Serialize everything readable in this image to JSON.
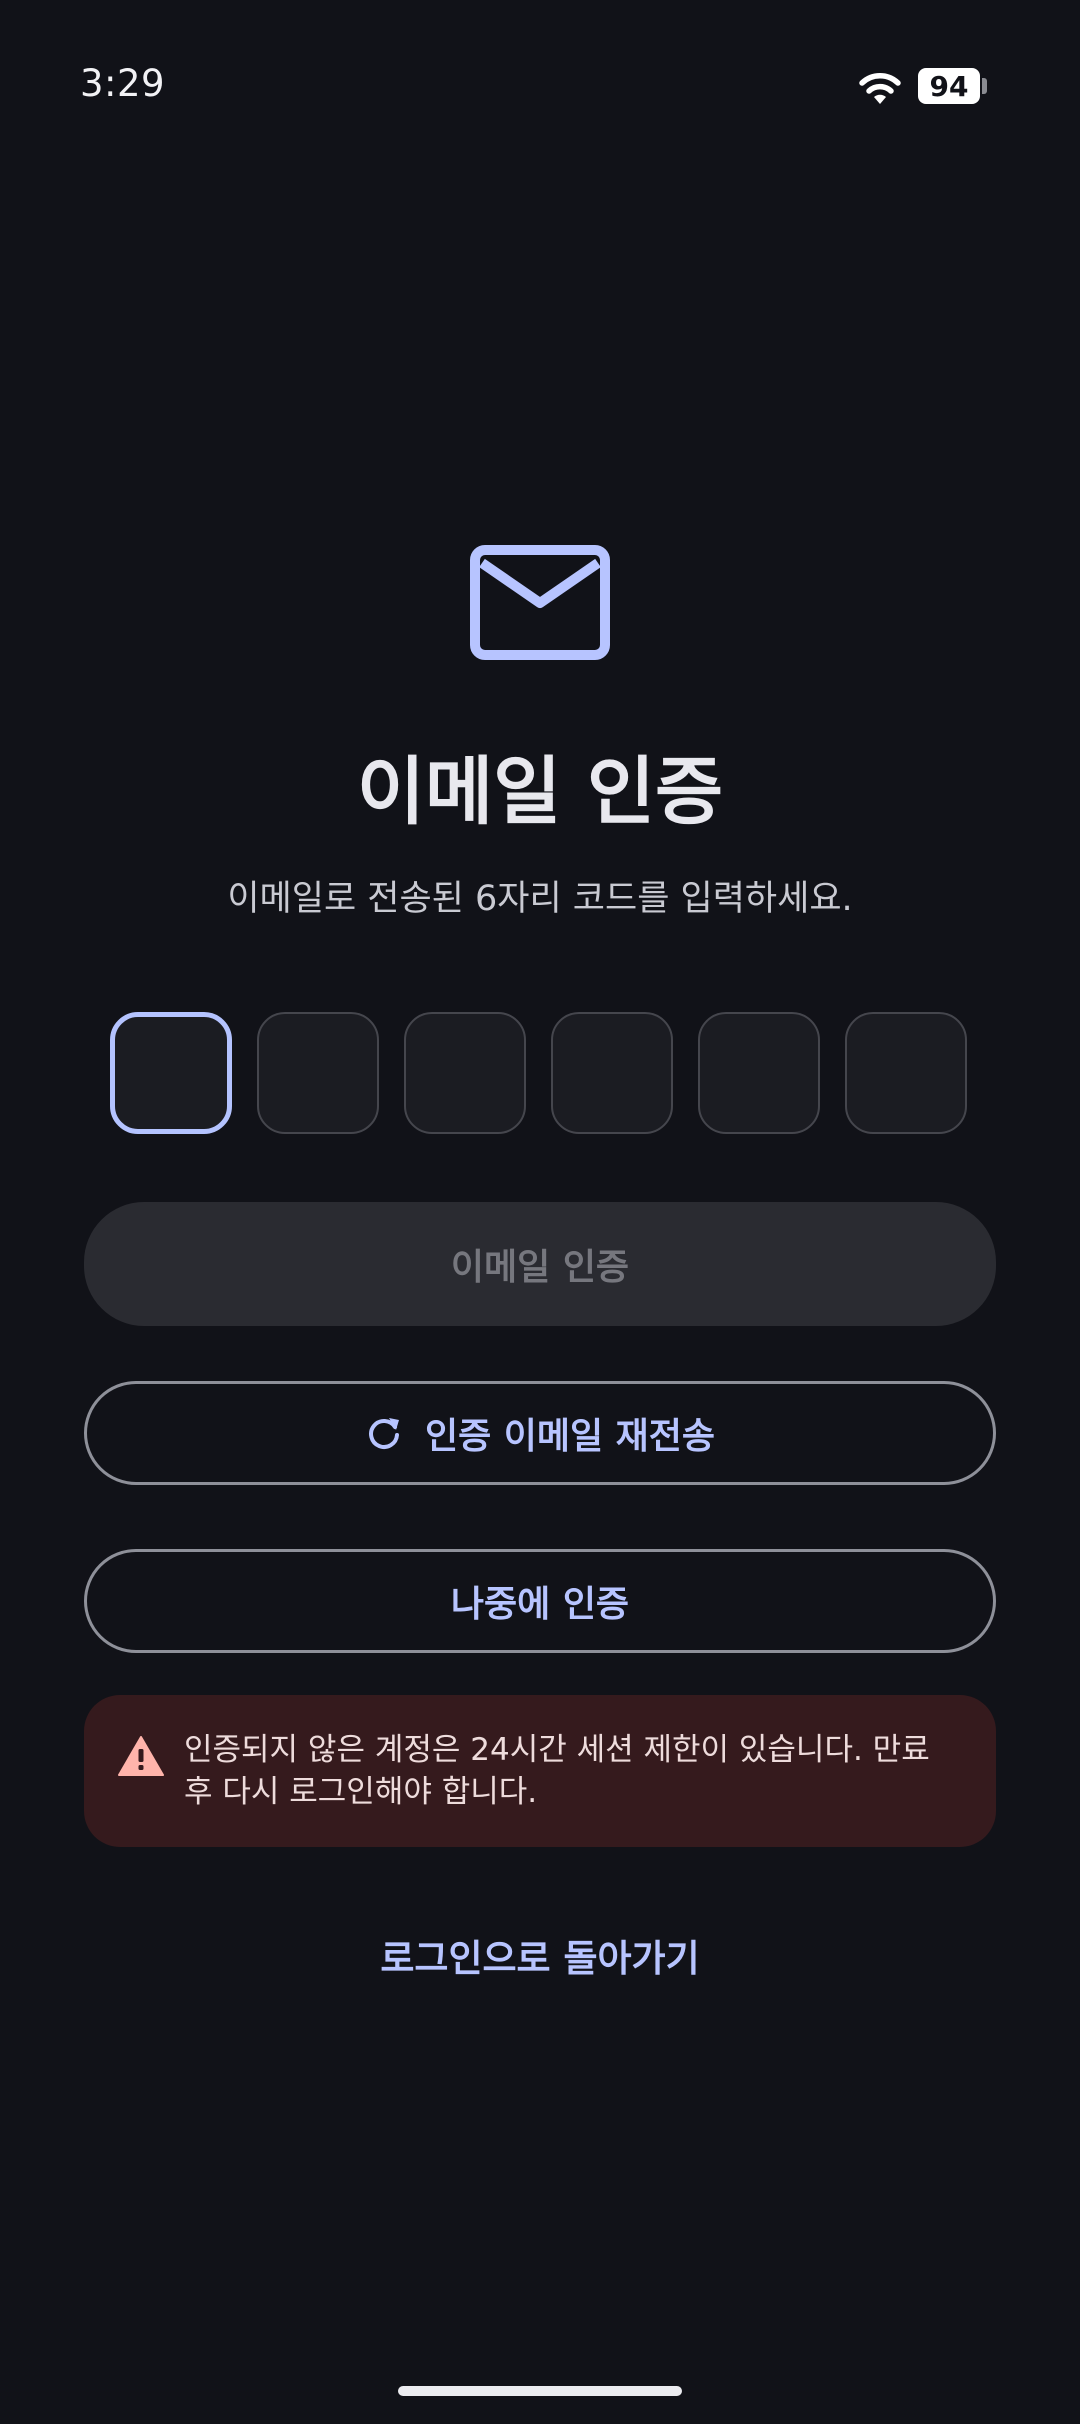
{
  "status_bar": {
    "time": "3:29",
    "battery_level": "94",
    "wifi_icon": "wifi-icon"
  },
  "colors": {
    "accent": "#b7c4ff",
    "background": "#111218",
    "warning_bg": "#351a1d",
    "warning_icon": "#ffb4ab"
  },
  "header": {
    "icon": "mail-icon",
    "title": "이메일 인증",
    "subtitle": "이메일로 전송된 6자리 코드를 입력하세요."
  },
  "code_input": {
    "digits": [
      "",
      "",
      "",
      "",
      "",
      ""
    ],
    "focused_index": 0
  },
  "actions": {
    "verify_label": "이메일 인증",
    "resend_label": "인증 이메일 재전송",
    "resend_icon": "refresh-icon",
    "later_label": "나중에 인증"
  },
  "warning": {
    "icon": "warning-icon",
    "text": "인증되지 않은 계정은 24시간 세션 제한이 있습니다. 만료 후 다시 로그인해야 합니다."
  },
  "footer": {
    "back_link": "로그인으로 돌아가기"
  }
}
